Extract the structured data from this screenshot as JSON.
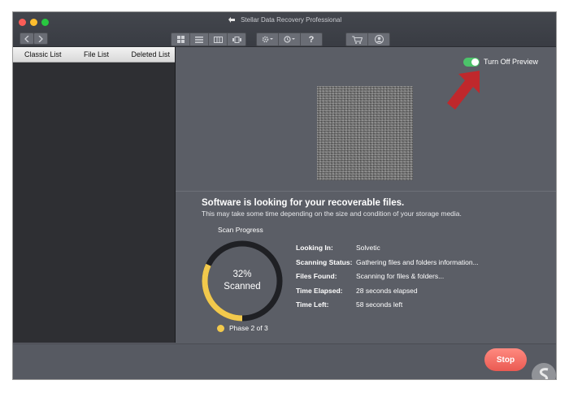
{
  "window": {
    "title": "Stellar Data Recovery Professional",
    "toolbar": {
      "back_icon": "chevron-left-icon",
      "forward_icon": "chevron-right-icon",
      "view_icons": [
        "grid-view-icon",
        "list-view-icon",
        "column-view-icon",
        "cover-flow-icon"
      ],
      "settings_icon": "gear-icon",
      "history_icon": "history-icon",
      "help_label": "?",
      "cart_icon": "cart-icon",
      "account_icon": "user-icon"
    }
  },
  "sidebar": {
    "tabs": [
      "Classic List",
      "File List",
      "Deleted List"
    ]
  },
  "preview": {
    "toggle_label": "Turn Off Preview",
    "toggle_on": true
  },
  "scan": {
    "heading": "Software is looking for your recoverable files.",
    "subheading": "This may take some time depending on the size and condition of your storage media.",
    "progress_label": "Scan Progress",
    "percent_text": "32%",
    "percent_value": 32,
    "scanned_label": "Scanned",
    "phase_text": "Phase 2 of 3",
    "details": [
      {
        "label": "Looking In:",
        "value": "Solvetic"
      },
      {
        "label": "Scanning Status:",
        "value": "Gathering files and folders information..."
      },
      {
        "label": "Files Found:",
        "value": "Scanning for files & folders..."
      },
      {
        "label": "Time Elapsed:",
        "value": "28 seconds elapsed"
      },
      {
        "label": "Time Left:",
        "value": "58 seconds left"
      }
    ]
  },
  "footer": {
    "stop_label": "Stop"
  },
  "colors": {
    "accent_toggle": "#4cc36a",
    "arrow": "#c0282c",
    "gauge_progress": "#f2c94c",
    "gauge_track": "#1f2024",
    "stop_button": "#ea5a52"
  }
}
